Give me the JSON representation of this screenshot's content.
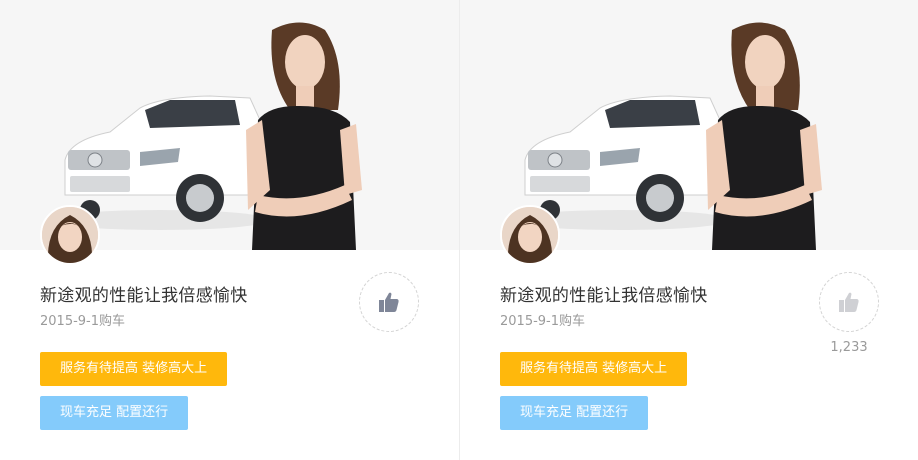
{
  "cards": [
    {
      "title": "新途观的性能让我倍感愉快",
      "date": "2015-9-1购车",
      "like_count": "",
      "like_active": true,
      "tags": [
        "服务有待提高  装修高大上",
        "现车充足  配置还行"
      ]
    },
    {
      "title": "新途观的性能让我倍感愉快",
      "date": "2015-9-1购车",
      "like_count": "1,233",
      "like_active": false,
      "tags": [
        "服务有待提高  装修高大上",
        "现车充足  配置还行"
      ]
    }
  ],
  "colors": {
    "tag_yellow": "#ffb80c",
    "tag_blue": "#84cbfb",
    "like_active": "#7f8698",
    "like_inactive": "#cfd0d4"
  },
  "icons": {
    "like": "thumbs-up-icon"
  }
}
